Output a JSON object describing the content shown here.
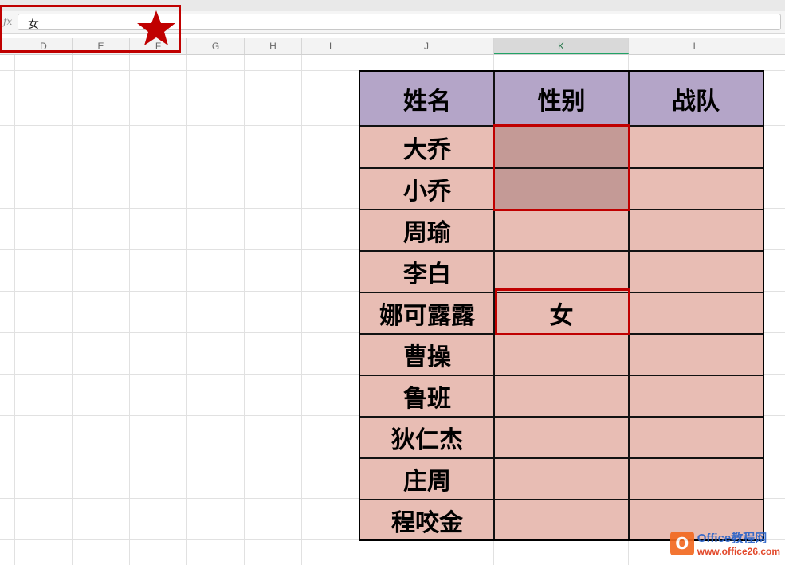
{
  "formula_bar": {
    "fx_label": "fx",
    "value": "女"
  },
  "columns": [
    {
      "label": "D"
    },
    {
      "label": "E"
    },
    {
      "label": "F"
    },
    {
      "label": "G"
    },
    {
      "label": "H"
    },
    {
      "label": "I"
    },
    {
      "label": "J"
    },
    {
      "label": "K",
      "active": true
    },
    {
      "label": "L"
    }
  ],
  "table": {
    "headers": [
      "姓名",
      "性别",
      "战队"
    ],
    "rows": [
      {
        "name": "大乔",
        "gender": "",
        "team": ""
      },
      {
        "name": "小乔",
        "gender": "",
        "team": ""
      },
      {
        "name": "周瑜",
        "gender": "",
        "team": ""
      },
      {
        "name": "李白",
        "gender": "",
        "team": ""
      },
      {
        "name": "娜可露露",
        "gender": "女",
        "team": ""
      },
      {
        "name": "曹操",
        "gender": "",
        "team": ""
      },
      {
        "name": "鲁班",
        "gender": "",
        "team": ""
      },
      {
        "name": "狄仁杰",
        "gender": "",
        "team": ""
      },
      {
        "name": "庄周",
        "gender": "",
        "team": ""
      },
      {
        "name": "程咬金",
        "gender": "",
        "team": ""
      }
    ]
  },
  "watermark": {
    "logo_letter": "O",
    "text": "Office教程网",
    "url": "www.office26.com"
  },
  "colors": {
    "header_fill": "#b4a5c8",
    "body_fill": "#e8bdb4",
    "selected_fill": "#c49a96",
    "highlight": "#c00000"
  }
}
